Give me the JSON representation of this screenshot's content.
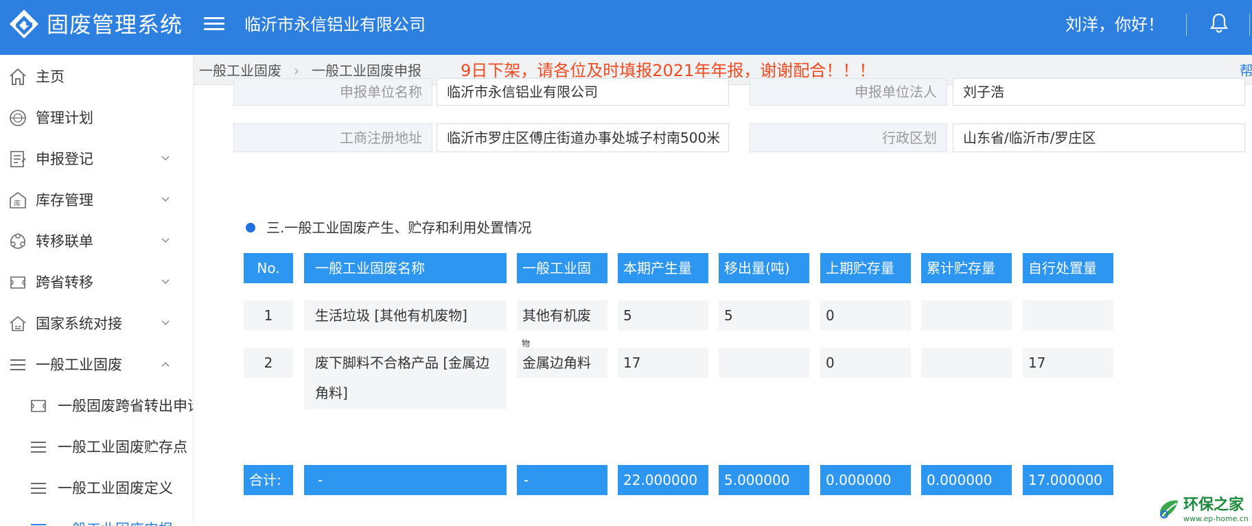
{
  "header": {
    "app_title": "固废管理系统",
    "company": "临沂市永信铝业有限公司",
    "greeting": "刘洋，你好！"
  },
  "sidebar": {
    "items": [
      {
        "label": "主页",
        "icon": "home-icon"
      },
      {
        "label": "管理计划",
        "icon": "plan-badge-icon"
      },
      {
        "label": "申报登记",
        "icon": "register-form-icon",
        "chevron": "down"
      },
      {
        "label": "库存管理",
        "icon": "warehouse-icon",
        "chevron": "down"
      },
      {
        "label": "转移联单",
        "icon": "transfer-cycle-icon",
        "chevron": "down"
      },
      {
        "label": "跨省转移",
        "icon": "cross-province-icon",
        "chevron": "down"
      },
      {
        "label": "国家系统对接",
        "icon": "national-system-icon",
        "chevron": "down"
      },
      {
        "label": "一般工业固废",
        "icon": "list-icon",
        "chevron": "up"
      }
    ],
    "sub_items": [
      {
        "label": "一般固废跨省转出申请",
        "icon": "cross-province-icon"
      },
      {
        "label": "一般工业固废贮存点",
        "icon": "list-icon"
      },
      {
        "label": "一般工业固废定义",
        "icon": "list-icon"
      },
      {
        "label": "一般工业固废申报",
        "icon": "list-icon"
      }
    ]
  },
  "breadcrumb": {
    "items": [
      "一般工业固废",
      "一般工业固废申报"
    ],
    "notice": "9日下架，请各位及时填报2021年年报，谢谢配合！！！",
    "help": "帮"
  },
  "form": {
    "unit_name_label": "申报单位名称",
    "unit_name_value": "临沂市永信铝业有限公司",
    "legal_person_label": "申报单位法人",
    "legal_person_value": "刘子浩",
    "address_label": "工商注册地址",
    "address_value": "临沂市罗庄区傅庄街道办事处城子村南500米",
    "region_label": "行政区划",
    "region_value": "山东省/临沂市/罗庄区"
  },
  "section": {
    "title": "三.一般工业固废产生、贮存和利用处置情况"
  },
  "table": {
    "headers": [
      "No.",
      "一般工业固废名称",
      "一般工业固",
      "本期产生量",
      "移出量(吨)",
      "上期贮存量",
      "累计贮存量",
      "自行处置量"
    ],
    "rows": [
      {
        "no": "1",
        "name": "生活垃圾 [其他有机废物]",
        "type": "其他有机废",
        "generated": "5",
        "moved_out": "5",
        "prev_storage": "0",
        "cum_storage": "",
        "self_disposal": ""
      },
      {
        "no": "2",
        "name": "废下脚料不合格产品 [金属边角料]",
        "type": "金属边角料",
        "type_note": "物",
        "generated": "17",
        "moved_out": "",
        "prev_storage": "0",
        "cum_storage": "",
        "self_disposal": "17"
      }
    ],
    "footer": {
      "label": "合计:",
      "name": "-",
      "type": "-",
      "generated": "22.000000",
      "moved_out": "5.000000",
      "prev_storage": "0.000000",
      "cum_storage": "0.000000",
      "self_disposal": "17.000000"
    }
  },
  "watermark": {
    "text": "环保之家",
    "url": "www.ep-home.cn"
  },
  "colors": {
    "header_bg": "#2d7fe0",
    "table_header_bg": "#2d96f0",
    "notice": "#f04a1f"
  }
}
